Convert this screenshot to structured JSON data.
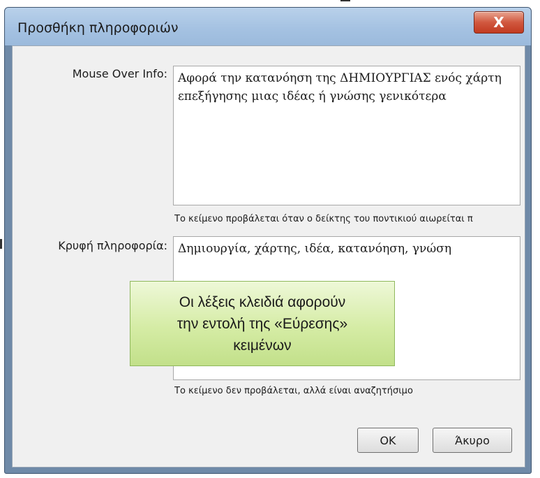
{
  "window": {
    "title": "Προσθήκη πληροφοριών",
    "close_label": "X"
  },
  "mouse_over": {
    "label": "Mouse Over Info:",
    "value": "Αφορά την κατανόηση της ΔΗΜΙΟΥΡΓΙΑΣ ενός χάρτη επεξήγησης μιας ιδέας ή γνώσης γενικότερα",
    "hint": "Το κείμενο προβάλεται όταν ο δείκτης του ποντικιού αιωρείται π"
  },
  "hidden_info": {
    "label": "Κρυφή πληροφορία:",
    "value": "Δημιουργία, χάρτης, ιδέα, κατανόηση, γνώση",
    "hint": "Το κείμενο δεν προβάλεται, αλλά είναι αναζητήσιμο"
  },
  "buttons": {
    "ok": "OK",
    "cancel": "Άκυρο"
  },
  "callout": {
    "line1": "Οι λέξεις κλειδιά αφορούν",
    "line2": "την εντολή της «Εύρεσης»",
    "line3": "κειμένων"
  }
}
